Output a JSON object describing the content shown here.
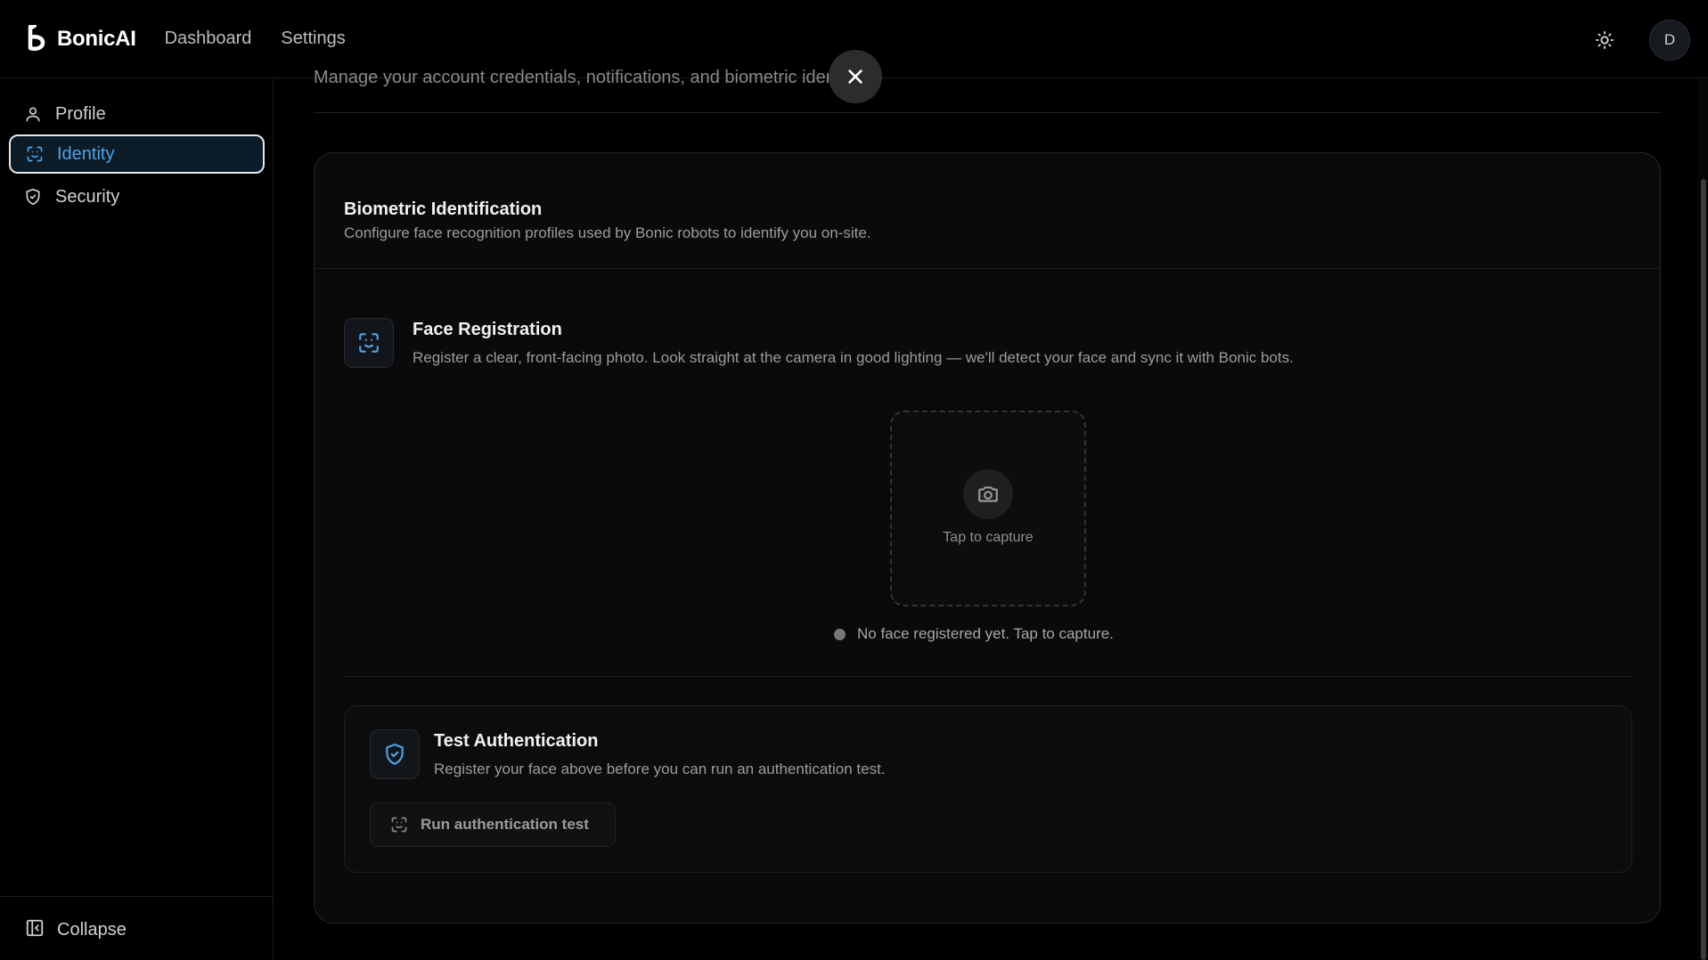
{
  "app": {
    "name": "BonicAI"
  },
  "topnav": {
    "items": [
      {
        "label": "Dashboard"
      },
      {
        "label": "Settings"
      }
    ]
  },
  "user": {
    "avatar_initial": "D"
  },
  "icons": {
    "theme": "sun-icon",
    "close": "close-icon",
    "camera": "camera-icon",
    "face_scan": "face-scan-icon",
    "shield": "shield-check-icon"
  },
  "colors": {
    "accent": "#4fa3e8",
    "active_bg": "#0b1b28",
    "background": "#000000"
  },
  "sidebar": {
    "items": [
      {
        "label": "Profile",
        "icon": "user-icon"
      },
      {
        "label": "Identity",
        "icon": "face-scan-icon",
        "active": true
      },
      {
        "label": "Security",
        "icon": "shield-check-icon"
      }
    ],
    "collapse_label": "Collapse"
  },
  "page": {
    "subtitle": "Manage your account credentials, notifications, and biometric identities."
  },
  "biometric": {
    "title": "Biometric Identification",
    "description": "Configure face recognition profiles used by Bonic robots to identify you on-site."
  },
  "face_registration": {
    "title": "Face Registration",
    "description": "Register a clear, front-facing photo. Look straight at the camera in good lighting — we'll detect your face and sync it with Bonic bots.",
    "capture_label": "Tap to capture",
    "status": "No face registered yet. Tap to capture."
  },
  "test_auth": {
    "title": "Test Authentication",
    "description": "Register your face above before you can run an authentication test.",
    "button_label": "Run authentication test"
  }
}
